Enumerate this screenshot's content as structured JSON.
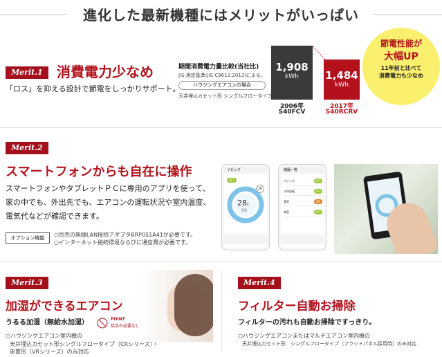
{
  "page_title": "進化した最新機種にはメリットがいっぱい",
  "colors": {
    "brand_red": "#b3121c",
    "dark_bar": "#3a3a3a",
    "badge_yellow": "#fbef6e"
  },
  "merit1": {
    "badge": "Merit.1",
    "title": "消費電力少なめ",
    "subtitle": "「ロス」を抑える設計で節電をしっかりサポート。",
    "comparison_title": "期間消費電力量比較(当社比)",
    "comparison_note": "JIS 測定基準(JIS C9612:2013)による。",
    "case_label": "ハウジングエアコンの場合",
    "case_type": "天井埋込カセット形 シングルフロータイプ",
    "bar_old": {
      "value": "1,908",
      "unit": "kWh",
      "year": "2006年",
      "model": "S40FCV"
    },
    "bar_new": {
      "value": "1,484",
      "unit": "kWh",
      "year": "2017年",
      "model": "S40RCRV"
    },
    "badge_circle": {
      "line1": "節電性能が",
      "line2": "大幅UP",
      "line3": "11年前と比べて",
      "line4": "消費電力も少なめ"
    }
  },
  "merit2": {
    "badge": "Merit.2",
    "title": "スマートフォンからも自在に操作",
    "body": [
      "スマートフォンやタブレットＰＣに専用のアプリを使って、",
      "家の中でも、外出先でも、エアコンの運転状況や室内温度、",
      "電気代などが確認できます。"
    ],
    "option_label": "オプション機能",
    "notes": [
      "○別売の無線LAN接続アダプタBRP051A41が必要です。",
      "○インターネット接続環境ならびに通信費が必要です。"
    ],
    "phone1": {
      "header": "リビング",
      "temp": "28",
      "unit": "c",
      "temp_label": "室温",
      "set_temp": "26",
      "off": "OFF"
    },
    "phone2": {
      "header": "機器一覧",
      "rooms": [
        {
          "name": "リビング",
          "status": "OFF"
        },
        {
          "name": "子供部屋",
          "status": "OFF"
        },
        {
          "name": "寝室",
          "status": "ON"
        },
        {
          "name": "和室",
          "status": "OFF"
        }
      ]
    }
  },
  "merit3": {
    "badge": "Merit.3",
    "title": "加湿ができるエアコン",
    "subtitle": "うるる加湿（無給水加湿）",
    "point_label": "POINT",
    "point_text": "給水の必要なし",
    "notes": [
      "○ハウジングエアコン室内機の",
      "天井埋込カセット形シングルフロータイプ（CRシリーズ）・",
      "床置形（VRシリーズ）のみ対応"
    ]
  },
  "merit4": {
    "badge": "Merit.4",
    "title": "フィルター自動お掃除",
    "subtitle": "フィルターの汚れも自動お掃除ですっきり。",
    "notes": [
      "○ハウジングエアコンまたはマルチエアコン室内機の",
      "天井埋込カセット形　シングルフロータイプ（フラットパネル採用時）のみ対応"
    ]
  }
}
